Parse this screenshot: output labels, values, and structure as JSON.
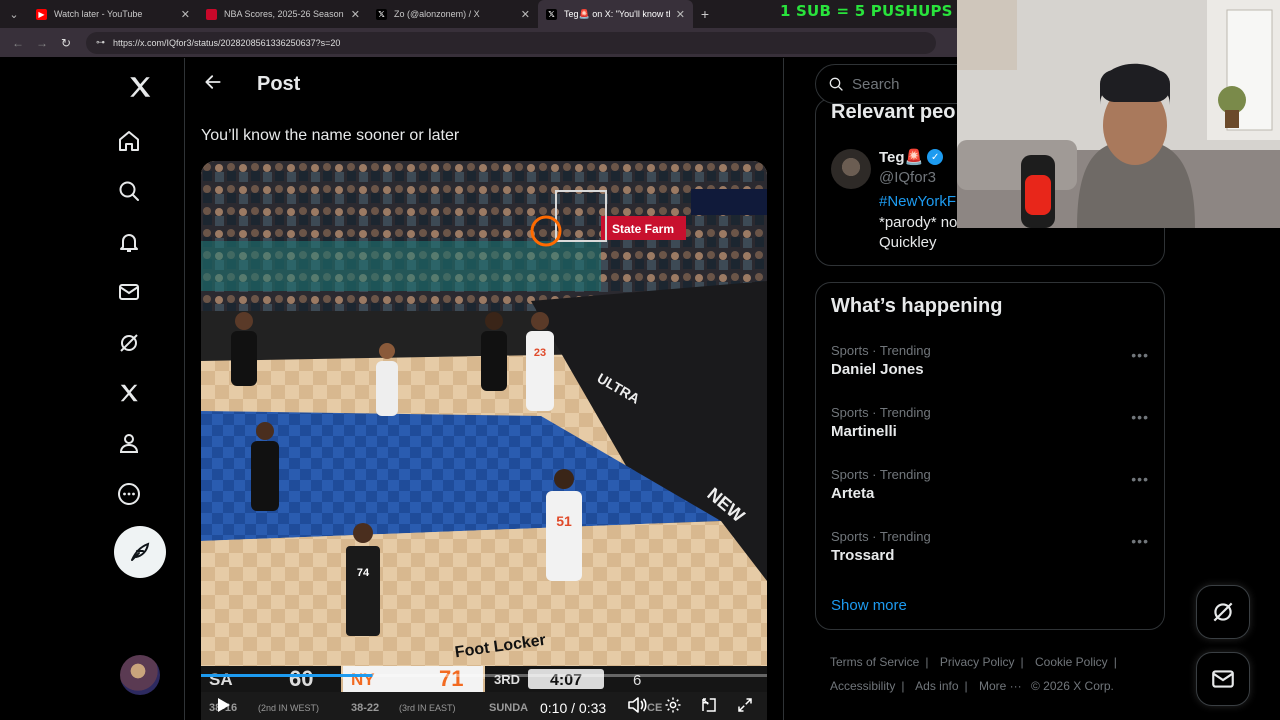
{
  "browser": {
    "tabs": [
      {
        "title": "Watch later - YouTube",
        "active": false
      },
      {
        "title": "NBA Scores, 2025-26 Season - ",
        "active": false
      },
      {
        "title": "Zo (@alonzonem) / X",
        "active": false
      },
      {
        "title": "Teg🚨 on X: \"You'll know the n",
        "active": true
      }
    ],
    "url": "https://x.com/IQfor3/status/2028208561336250637?s=20"
  },
  "banner": "1 SUB = 5 PUSHUPS",
  "nav": {
    "items": [
      "x-logo",
      "home",
      "explore",
      "notifications",
      "messages",
      "grok",
      "premium",
      "profile",
      "more"
    ]
  },
  "post": {
    "header_title": "Post",
    "text": "You’ll know the name sooner or later",
    "video": {
      "time": "0:10 / 0:33",
      "scoreboard": {
        "away": "SA",
        "away_score": "60",
        "home": "NY",
        "home_score": "71",
        "quarter": "3RD",
        "clock": "4:07",
        "shot_clock": "6",
        "away_record": "38-16",
        "away_rank": "(2nd IN WEST)",
        "home_record": "38-22",
        "home_rank": "(3rd IN EAST)",
        "sponsor_left": "SUNDA",
        "sponsor_right": "CE"
      },
      "court_text": [
        "State Farm",
        "Foot Locker",
        "ULTRA",
        "NEW"
      ],
      "jerseys": [
        "51",
        "74",
        "23"
      ]
    }
  },
  "search": {
    "placeholder": "Search"
  },
  "relevant_people": {
    "title": "Relevant peo",
    "name": "Teg🚨",
    "handle": "@IQfor3",
    "tag": "#NewYorkF",
    "bio_line1": "*parody* no",
    "bio_line1_tail": "...",
    "bio_line2": "Quickley"
  },
  "whats_happening": {
    "title": "What’s happening",
    "trends": [
      {
        "meta": "Sports · Trending",
        "name": "Daniel Jones"
      },
      {
        "meta": "Sports · Trending",
        "name": "Martinelli"
      },
      {
        "meta": "Sports · Trending",
        "name": "Arteta"
      },
      {
        "meta": "Sports · Trending",
        "name": "Trossard"
      }
    ],
    "show_more": "Show more"
  },
  "footer": {
    "links": [
      "Terms of Service",
      "Privacy Policy",
      "Cookie Policy",
      "Accessibility",
      "Ads info",
      "More ···"
    ],
    "copyright": "© 2026 X Corp."
  },
  "colors": {
    "accent": "#1d9bf0",
    "banner": "#29e33c",
    "background": "#000000"
  }
}
